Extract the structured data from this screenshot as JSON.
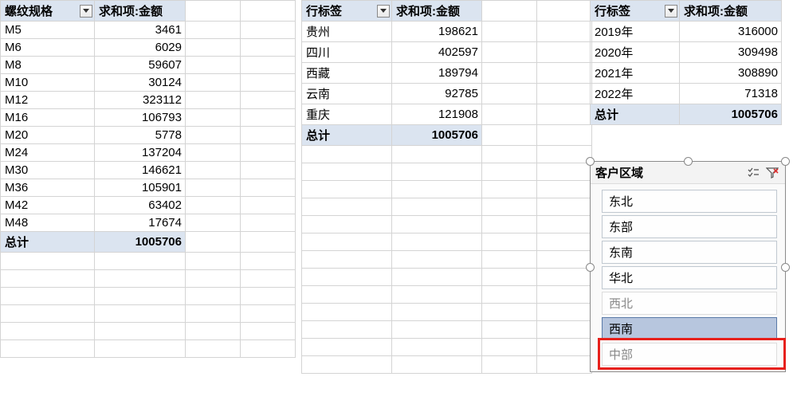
{
  "pivot1": {
    "header1": "螺纹规格",
    "header2": "求和项:金额",
    "rows": [
      {
        "label": "M5",
        "value": "3461"
      },
      {
        "label": "M6",
        "value": "6029"
      },
      {
        "label": "M8",
        "value": "59607"
      },
      {
        "label": "M10",
        "value": "30124"
      },
      {
        "label": "M12",
        "value": "323112"
      },
      {
        "label": "M16",
        "value": "106793"
      },
      {
        "label": "M20",
        "value": "5778"
      },
      {
        "label": "M24",
        "value": "137204"
      },
      {
        "label": "M30",
        "value": "146621"
      },
      {
        "label": "M36",
        "value": "105901"
      },
      {
        "label": "M42",
        "value": "63402"
      },
      {
        "label": "M48",
        "value": "17674"
      }
    ],
    "total_label": "总计",
    "total_value": "1005706"
  },
  "pivot2": {
    "header1": "行标签",
    "header2": "求和项:金额",
    "rows": [
      {
        "label": "贵州",
        "value": "198621"
      },
      {
        "label": "四川",
        "value": "402597"
      },
      {
        "label": "西藏",
        "value": "189794"
      },
      {
        "label": "云南",
        "value": "92785"
      },
      {
        "label": "重庆",
        "value": "121908"
      }
    ],
    "total_label": "总计",
    "total_value": "1005706"
  },
  "pivot3": {
    "header1": "行标签",
    "header2": "求和项:金额",
    "rows": [
      {
        "label": "2019年",
        "value": "316000"
      },
      {
        "label": "2020年",
        "value": "309498"
      },
      {
        "label": "2021年",
        "value": "308890"
      },
      {
        "label": "2022年",
        "value": "71318"
      }
    ],
    "total_label": "总计",
    "total_value": "1005706"
  },
  "slicer": {
    "title": "客户区域",
    "items": [
      {
        "label": "东北",
        "state": "normal"
      },
      {
        "label": "东部",
        "state": "normal"
      },
      {
        "label": "东南",
        "state": "normal"
      },
      {
        "label": "华北",
        "state": "normal"
      },
      {
        "label": "西北",
        "state": "dim"
      },
      {
        "label": "西南",
        "state": "selected"
      },
      {
        "label": "中部",
        "state": "dim"
      }
    ],
    "multi_icon": "≣",
    "clear_icon": "⌀"
  }
}
